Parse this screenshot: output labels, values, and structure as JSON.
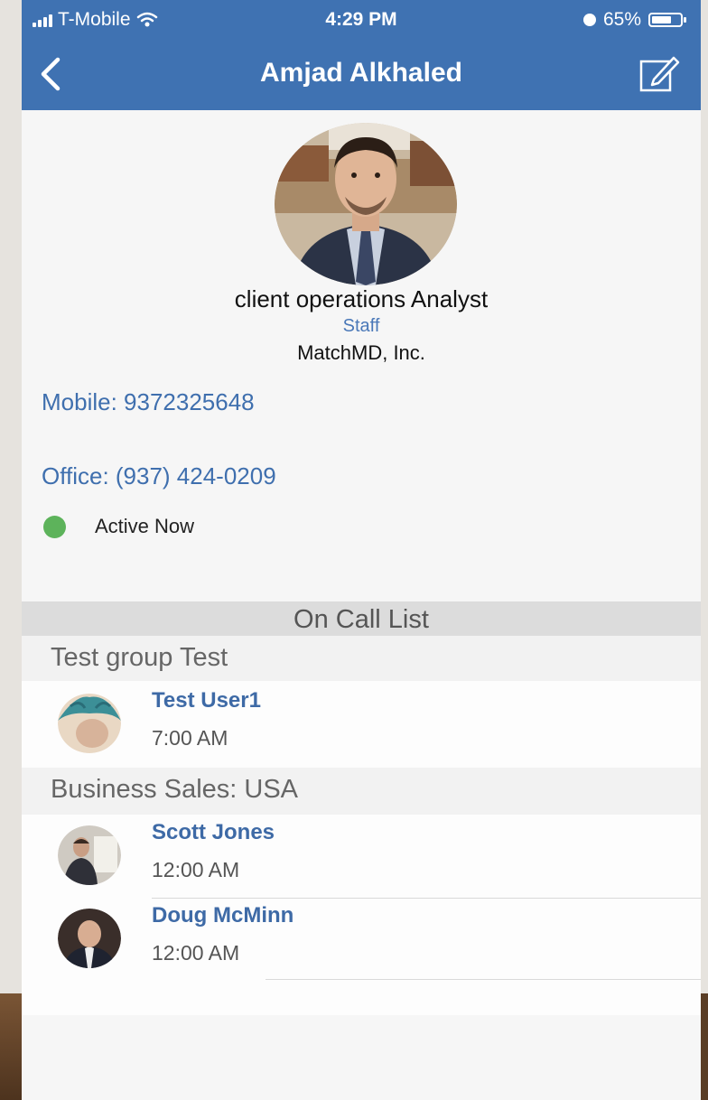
{
  "status_bar": {
    "carrier": "T-Mobile",
    "time": "4:29 PM",
    "battery": "65%"
  },
  "header": {
    "title": "Amjad Alkhaled",
    "back_icon": "chevron-left-icon",
    "edit_icon": "compose-icon",
    "background_color": "#3f72b2"
  },
  "profile": {
    "job_title": "client operations Analyst",
    "role": "Staff",
    "company": "MatchMD, Inc.",
    "mobile": "Mobile: 9372325648",
    "office": "Office: (937) 424-0209",
    "presence": "Active Now",
    "presence_color": "#5db35b"
  },
  "on_call": {
    "heading": "On Call List",
    "groups": [
      {
        "name": "Test group Test",
        "members": [
          {
            "name": "Test User1",
            "time": "7:00 AM"
          }
        ]
      },
      {
        "name": "Business Sales: USA",
        "members": [
          {
            "name": "Scott Jones",
            "time": "12:00 AM"
          },
          {
            "name": "Doug McMinn",
            "time": "12:00 AM"
          }
        ]
      }
    ]
  }
}
